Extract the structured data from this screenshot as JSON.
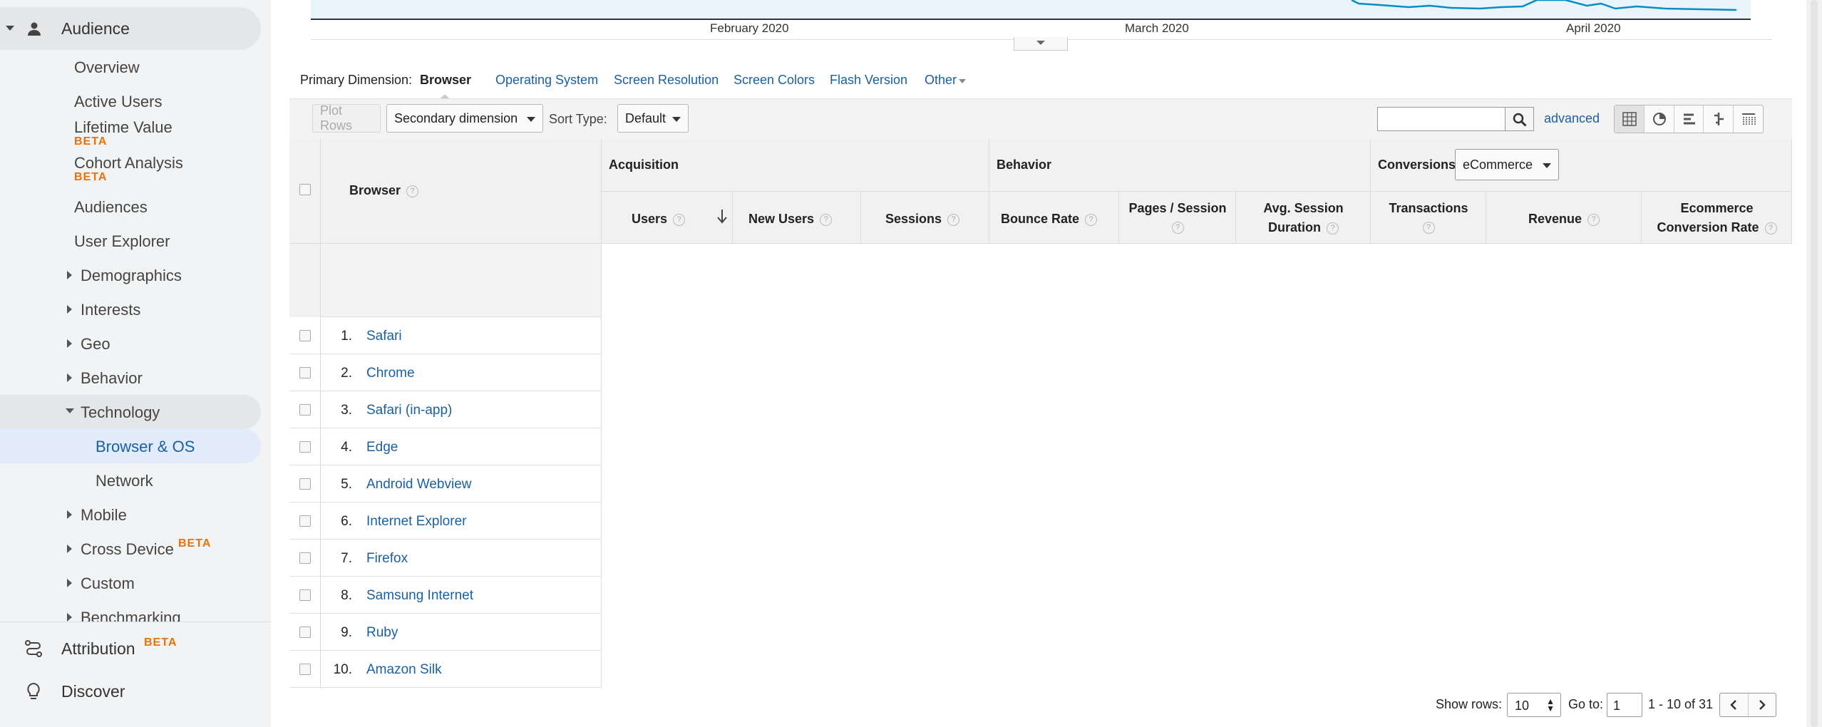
{
  "sidebar": {
    "audience": "Audience",
    "items": {
      "overview": "Overview",
      "active_users": "Active Users",
      "lifetime_value": "Lifetime Value",
      "cohort_analysis": "Cohort Analysis",
      "audiences": "Audiences",
      "user_explorer": "User Explorer",
      "demographics": "Demographics",
      "interests": "Interests",
      "geo": "Geo",
      "behavior": "Behavior",
      "technology": "Technology",
      "browser_os": "Browser & OS",
      "network": "Network",
      "mobile": "Mobile",
      "cross_device": "Cross Device",
      "custom": "Custom",
      "benchmarking": "Benchmarking"
    },
    "beta": "BETA",
    "attribution": "Attribution",
    "discover": "Discover"
  },
  "chart": {
    "labels": [
      "February 2020",
      "March 2020",
      "April 2020"
    ]
  },
  "primary_dimension": {
    "label": "Primary Dimension:",
    "active": "Browser",
    "links": [
      "Operating System",
      "Screen Resolution",
      "Screen Colors",
      "Flash Version",
      "Other"
    ]
  },
  "toolbar": {
    "plot_rows": "Plot Rows",
    "secondary_dimension": "Secondary dimension",
    "sort_type_label": "Sort Type:",
    "sort_type_value": "Default",
    "advanced": "advanced"
  },
  "table": {
    "browser_header": "Browser",
    "groups": {
      "acquisition": "Acquisition",
      "behavior": "Behavior",
      "conversions": "Conversions"
    },
    "conversions_select": "eCommerce",
    "columns": {
      "users": "Users",
      "new_users": "New Users",
      "sessions": "Sessions",
      "bounce_rate": "Bounce Rate",
      "pages_session": "Pages / Session",
      "avg_session_1": "Avg. Session",
      "avg_session_2": "Duration",
      "transactions": "Transactions",
      "revenue": "Revenue",
      "ecom_1": "Ecommerce",
      "ecom_2": "Conversion Rate"
    },
    "help": "?",
    "rows": [
      {
        "num": "1.",
        "name": "Safari"
      },
      {
        "num": "2.",
        "name": "Chrome"
      },
      {
        "num": "3.",
        "name": "Safari (in-app)"
      },
      {
        "num": "4.",
        "name": "Edge"
      },
      {
        "num": "5.",
        "name": "Android Webview"
      },
      {
        "num": "6.",
        "name": "Internet Explorer"
      },
      {
        "num": "7.",
        "name": "Firefox"
      },
      {
        "num": "8.",
        "name": "Samsung Internet"
      },
      {
        "num": "9.",
        "name": "Ruby"
      },
      {
        "num": "10.",
        "name": "Amazon Silk"
      }
    ]
  },
  "pager": {
    "show_rows_label": "Show rows:",
    "show_rows_value": "10",
    "goto_label": "Go to:",
    "goto_value": "1",
    "range": "1 - 10 of 31"
  },
  "colors": {
    "link": "#1a5f9e",
    "beta": "#e8710a",
    "active_nav_bg": "#e2ebf9"
  }
}
